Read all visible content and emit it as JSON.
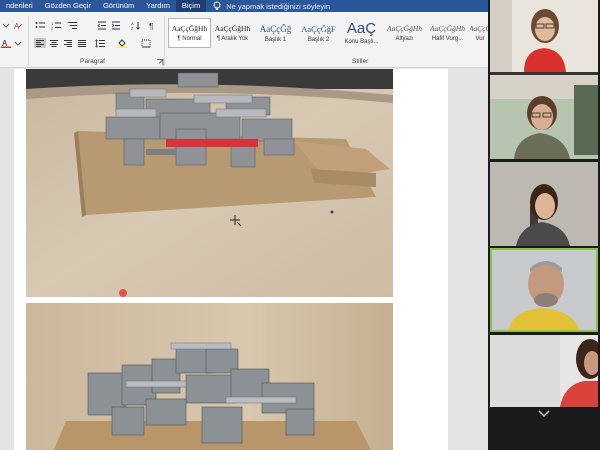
{
  "menubar": {
    "tabs": [
      "nderileri",
      "Gözden Geçir",
      "Görünüm",
      "Yardım",
      "Biçim"
    ],
    "active_tab": "Biçim",
    "tell_me": "Ne yapmak istediğinizi söyleyin"
  },
  "ribbon": {
    "paragraph_label": "Paragraf",
    "styles_label": "Stiller",
    "styles": [
      {
        "preview": "AaÇçĞğHh",
        "name": "¶ Normal",
        "selected": true
      },
      {
        "preview": "AaÇçĞğHh",
        "name": "¶ Aralık Yok"
      },
      {
        "preview": "AaÇçĞğ",
        "name": "Başlık 1"
      },
      {
        "preview": "AaÇçĞğF",
        "name": "Başlık 2"
      },
      {
        "preview": "AaÇ",
        "name": "Konu Başlı..."
      },
      {
        "preview": "AaÇçĞğHh",
        "name": "Altyazı"
      },
      {
        "preview": "AaÇçĞğHh",
        "name": "Hafif Vurg..."
      },
      {
        "preview": "AaÇçĞ",
        "name": "Vur"
      }
    ]
  },
  "document": {
    "images": [
      "architectural-model-photo-1",
      "architectural-model-photo-2"
    ]
  },
  "zoom": {
    "participants": [
      "participant-1",
      "participant-2",
      "participant-3",
      "participant-4",
      "participant-5"
    ],
    "active_speaker_index": 3
  },
  "colors": {
    "word_blue": "#2b579a",
    "active_speaker": "#8bc34a",
    "laser_pointer": "#e8504a"
  }
}
